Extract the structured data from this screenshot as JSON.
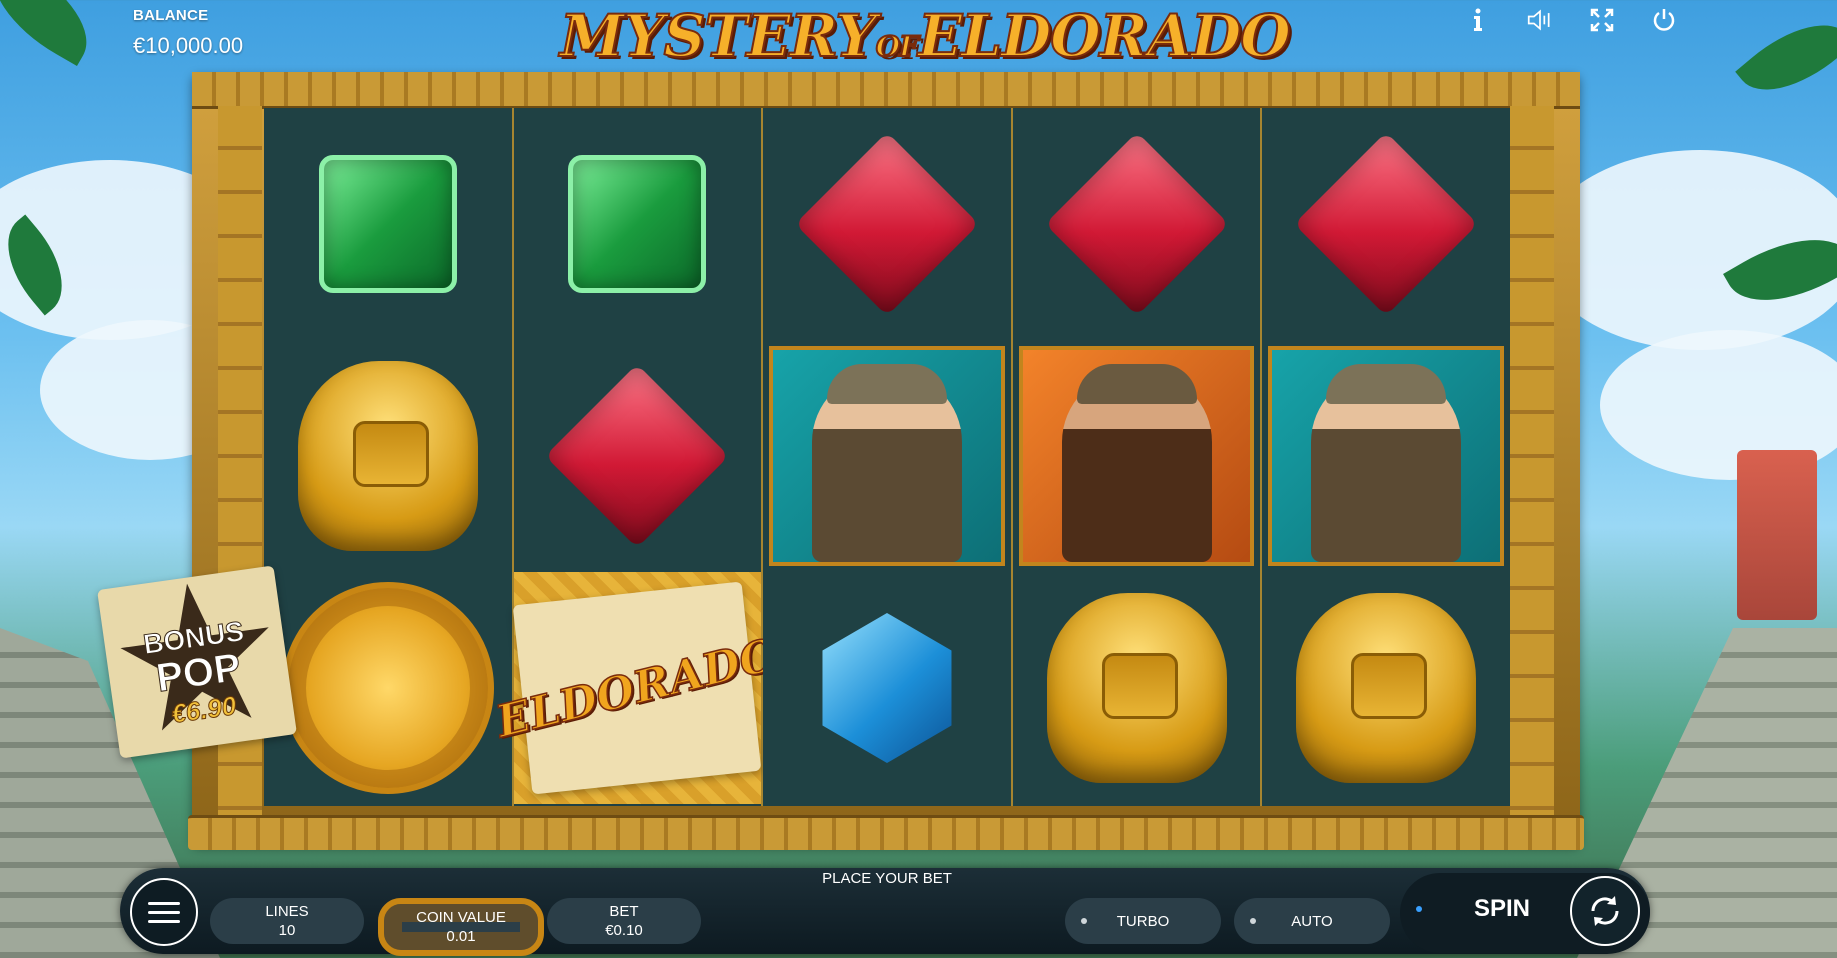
{
  "balance": {
    "label": "BALANCE",
    "value": "€10,000.00"
  },
  "game": {
    "title_main": "MYSTERY",
    "title_of": "OF",
    "title_end": "ELDORADO"
  },
  "top_icons": [
    "info-icon",
    "sound-icon",
    "fullscreen-icon",
    "power-icon"
  ],
  "reels": [
    [
      "green-gem",
      "gold-idol",
      "gold-coin"
    ],
    [
      "green-gem",
      "red-gem",
      "eldorado-map"
    ],
    [
      "red-gem",
      "explorer-woman",
      "blue-gem"
    ],
    [
      "red-gem",
      "explorer-man",
      "gold-idol"
    ],
    [
      "red-gem",
      "explorer-woman",
      "gold-idol"
    ]
  ],
  "map_label": "ELDORADO",
  "bonus": {
    "line1": "BONUS",
    "line2": "POP",
    "value": "€6.90"
  },
  "controls": {
    "status": "PLACE YOUR BET",
    "lines_label": "LINES",
    "lines_value": "10",
    "coin_label": "COIN VALUE",
    "coin_value": "0.01",
    "bet_label": "BET",
    "bet_value": "€0.10",
    "turbo_label": "TURBO",
    "auto_label": "AUTO",
    "spin_label": "SPIN"
  },
  "colors": {
    "frame_gold": "#c99a36",
    "reel_bg": "#1f4144",
    "spin_indicator": "#39a0ff"
  }
}
